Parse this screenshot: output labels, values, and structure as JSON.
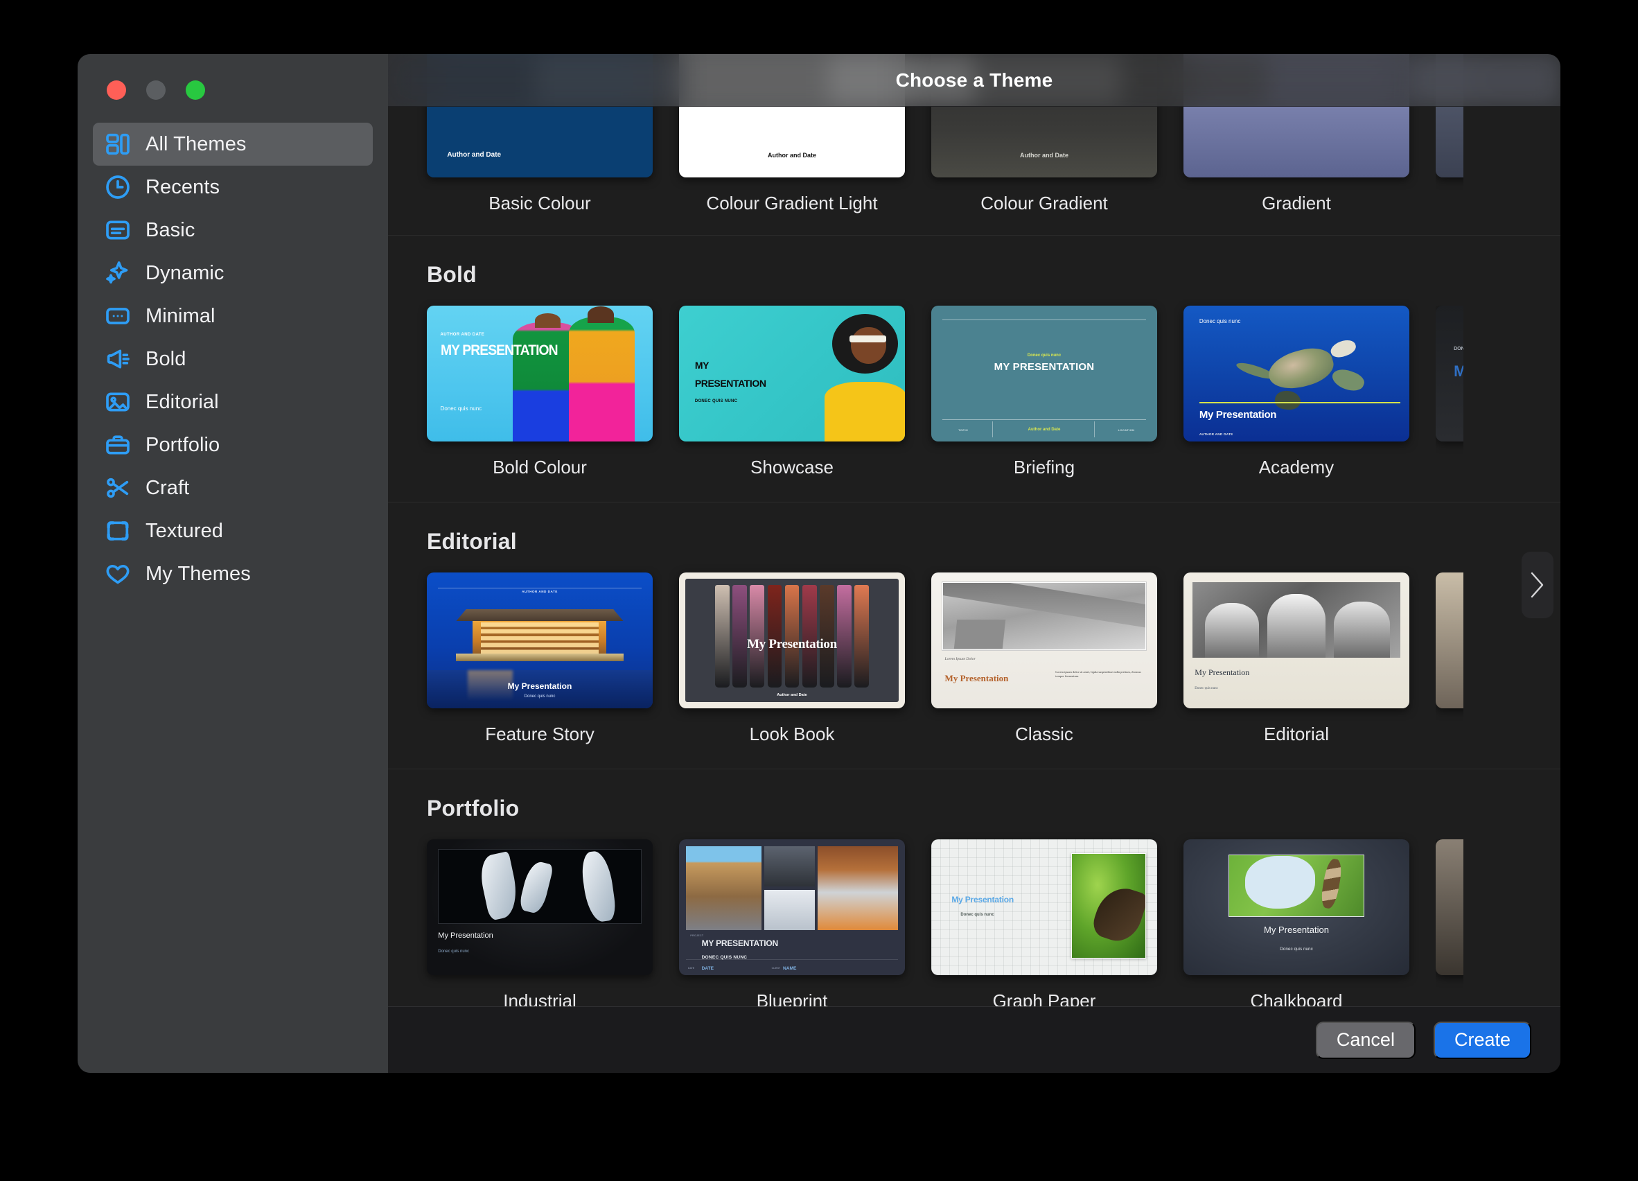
{
  "window": {
    "title": "Choose a Theme",
    "traffic_lights": [
      "close",
      "minimize",
      "zoom"
    ]
  },
  "sidebar": {
    "items": [
      {
        "label": "All Themes",
        "icon": "grid-icon",
        "selected": true
      },
      {
        "label": "Recents",
        "icon": "clock-icon",
        "selected": false
      },
      {
        "label": "Basic",
        "icon": "document-icon",
        "selected": false
      },
      {
        "label": "Dynamic",
        "icon": "sparkles-icon",
        "selected": false
      },
      {
        "label": "Minimal",
        "icon": "ellipsis-box-icon",
        "selected": false
      },
      {
        "label": "Bold",
        "icon": "megaphone-icon",
        "selected": false
      },
      {
        "label": "Editorial",
        "icon": "photo-icon",
        "selected": false
      },
      {
        "label": "Portfolio",
        "icon": "briefcase-icon",
        "selected": false
      },
      {
        "label": "Craft",
        "icon": "scissors-icon",
        "selected": false
      },
      {
        "label": "Textured",
        "icon": "frame-icon",
        "selected": false
      },
      {
        "label": "My Themes",
        "icon": "heart-icon",
        "selected": false
      }
    ]
  },
  "main": {
    "scroll_arrow_icon": "chevron-right-icon",
    "sections": [
      {
        "heading": "",
        "clipped": true,
        "themes": [
          {
            "name": "Basic Colour",
            "art": "a-basiccolour",
            "selected": false
          },
          {
            "name": "Colour Gradient Light",
            "art": "a-cgl",
            "selected": false
          },
          {
            "name": "Colour Gradient",
            "art": "a-cg",
            "selected": false
          },
          {
            "name": "Gradient",
            "art": "a-grad",
            "selected": false
          }
        ]
      },
      {
        "heading": "Bold",
        "clipped": false,
        "themes": [
          {
            "name": "Bold Colour",
            "art": "a-boldcolour",
            "selected": false
          },
          {
            "name": "Showcase",
            "art": "a-showcase",
            "selected": false
          },
          {
            "name": "Briefing",
            "art": "a-briefing",
            "selected": false
          },
          {
            "name": "Academy",
            "art": "a-academy",
            "selected": false
          }
        ]
      },
      {
        "heading": "Editorial",
        "clipped": false,
        "themes": [
          {
            "name": "Feature Story",
            "art": "a-feature",
            "selected": false
          },
          {
            "name": "Look Book",
            "art": "a-lookbook",
            "selected": true
          },
          {
            "name": "Classic",
            "art": "a-classic",
            "selected": false
          },
          {
            "name": "Editorial",
            "art": "a-editorial",
            "selected": false
          }
        ]
      },
      {
        "heading": "Portfolio",
        "clipped": false,
        "themes": [
          {
            "name": "Industrial",
            "art": "a-industrial",
            "selected": false
          },
          {
            "name": "Blueprint",
            "art": "a-blueprint",
            "selected": false
          },
          {
            "name": "Graph Paper",
            "art": "a-graph",
            "selected": false
          },
          {
            "name": "Chalkboard",
            "art": "a-chalk",
            "selected": false
          }
        ]
      }
    ],
    "slide_text": {
      "basic_colour": {
        "author": "Author and Date"
      },
      "colour_gradient_light": {
        "author": "Author and Date"
      },
      "colour_gradient": {
        "author": "Author and Date"
      },
      "bold_colour": {
        "author": "AUTHOR AND DATE",
        "title": "MY PRESENTATION",
        "subtitle": "Donec quis nunc"
      },
      "showcase": {
        "title_line1": "MY",
        "title_line2": "PRESENTATION",
        "subtitle": "DONEC QUIS NUNC"
      },
      "briefing": {
        "subtitle": "Donec quis nunc",
        "title": "MY PRESENTATION",
        "footer_left": "TOPIC",
        "footer_center": "Author and Date",
        "footer_right": "LOCATION"
      },
      "academy": {
        "subtitle": "Donec quis nunc",
        "title": "My Presentation",
        "author": "AUTHOR AND DATE"
      },
      "feature_story": {
        "author": "AUTHOR AND DATE",
        "title": "My Presentation",
        "subtitle": "Donec quis nunc"
      },
      "look_book": {
        "title": "My Presentation",
        "author": "Author and Date"
      },
      "classic": {
        "eyebrow": "Lorem Ipsum Dolor",
        "title": "My Presentation",
        "body": "Lorem ipsum dolor sit amet, ligula suspendisse nulla pretium, rhoncus tempor fermentum."
      },
      "editorial": {
        "title": "My Presentation",
        "subtitle": "Donec quis nunc"
      },
      "industrial": {
        "title": "My Presentation",
        "subtitle": "Donec quis nunc"
      },
      "blueprint": {
        "label_project": "PROJECT",
        "title": "MY PRESENTATION",
        "subtitle": "DONEC QUIS NUNC",
        "label_date": "DATE",
        "value_date": "DATE",
        "label_client": "CLIENT",
        "value_client": "NAME"
      },
      "graph_paper": {
        "title": "My Presentation",
        "subtitle": "Donec quis nunc"
      },
      "chalkboard": {
        "title": "My Presentation",
        "subtitle": "Donec quis nunc"
      },
      "peek_bold": {
        "eyebrow": "DON",
        "title": "M"
      }
    }
  },
  "footer": {
    "cancel_label": "Cancel",
    "create_label": "Create"
  },
  "colors": {
    "accent": "#1a73e8",
    "sidebar_bg": "#3a3c3e",
    "content_bg": "#1e1e1e",
    "sidebar_icon": "#2e9df5",
    "selected_row": "#5b5d60",
    "traffic_red": "#ff5f57",
    "traffic_yellow": "#5b5e61",
    "traffic_green": "#28c840"
  }
}
